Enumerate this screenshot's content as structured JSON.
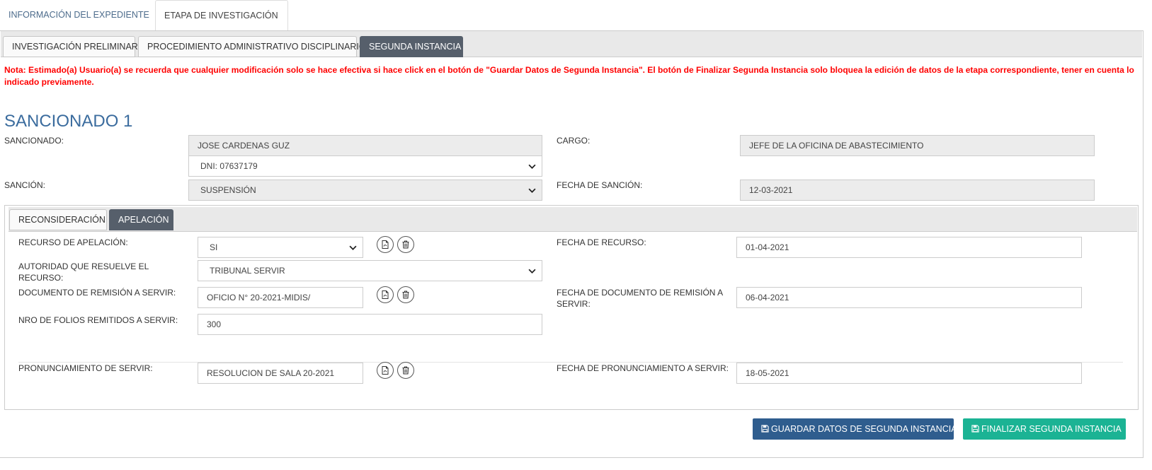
{
  "top_tabs": [
    {
      "label": "INFORMACIÓN DEL EXPEDIENTE",
      "active": false
    },
    {
      "label": "ETAPA DE INVESTIGACIÓN",
      "active": true
    }
  ],
  "sub_tabs": [
    {
      "label": "INVESTIGACIÓN PRELIMINAR",
      "active": false
    },
    {
      "label": "PROCEDIMIENTO ADMINISTRATIVO DISCIPLINARIO",
      "active": false
    },
    {
      "label": "SEGUNDA INSTANCIA",
      "active": true
    }
  ],
  "note": "Nota: Estimado(a) Usuario(a) se recuerda que cualquier modificación solo se hace efectiva si hace click en el botón de \"Guardar Datos de Segunda Instancia\". El botón de Finalizar Segunda Instancia solo bloquea la edición de datos de la etapa correspondiente, tener en cuenta lo indicado previamente.",
  "section_title": "SANCIONADO 1",
  "sancionado": {
    "label": "SANCIONADO:",
    "name": "JOSE CARDENAS GUZ",
    "dni_selected": "DNI: 07637179"
  },
  "cargo": {
    "label": "CARGO:",
    "value": "JEFE DE LA OFICINA DE ABASTECIMIENTO"
  },
  "sancion": {
    "label": "SANCIÓN:",
    "selected": "SUSPENSIÓN"
  },
  "fecha_sancion": {
    "label": "FECHA DE SANCIÓN:",
    "value": "12-03-2021"
  },
  "inner_tabs": [
    {
      "label": "RECONSIDERACIÓN",
      "active": false
    },
    {
      "label": "APELACIÓN",
      "active": true
    }
  ],
  "apelacion": {
    "recurso_label": "RECURSO DE APELACIÓN:",
    "recurso_selected": "SI",
    "fecha_recurso_label": "FECHA DE RECURSO:",
    "fecha_recurso_value": "01-04-2021",
    "autoridad_label": "AUTORIDAD QUE RESUELVE EL RECURSO:",
    "autoridad_selected": "TRIBUNAL SERVIR",
    "doc_remision_label": "DOCUMENTO DE REMISIÓN A SERVIR:",
    "doc_remision_value": "OFICIO N° 20-2021-MIDIS/",
    "fecha_doc_remision_label": "FECHA DE DOCUMENTO DE REMISIÓN A SERVIR:",
    "fecha_doc_remision_value": "06-04-2021",
    "nro_folios_label": "NRO DE FOLIOS REMITIDOS A SERVIR:",
    "nro_folios_value": "300",
    "pronunciamiento_label": "PRONUNCIAMIENTO DE SERVIR:",
    "pronunciamiento_value": "RESOLUCION DE SALA 20-2021",
    "fecha_pronunciamiento_label": "FECHA DE PRONUNCIAMIENTO A SERVIR:",
    "fecha_pronunciamiento_value": "18-05-2021"
  },
  "buttons": {
    "guardar": "GUARDAR DATOS DE SEGUNDA INSTANCIA",
    "finalizar": "FINALIZAR SEGUNDA INSTANCIA"
  },
  "colors": {
    "accent_blue": "#2f5d8e",
    "accent_green": "#1bb394",
    "note_red": "#ff0000",
    "title_blue": "#3b6c9e",
    "active_tab": "#565f6b"
  },
  "icons": {
    "pdf": "file-pdf-icon",
    "delete": "trash-icon",
    "save": "save-icon",
    "select": "chevron-down-icon"
  }
}
